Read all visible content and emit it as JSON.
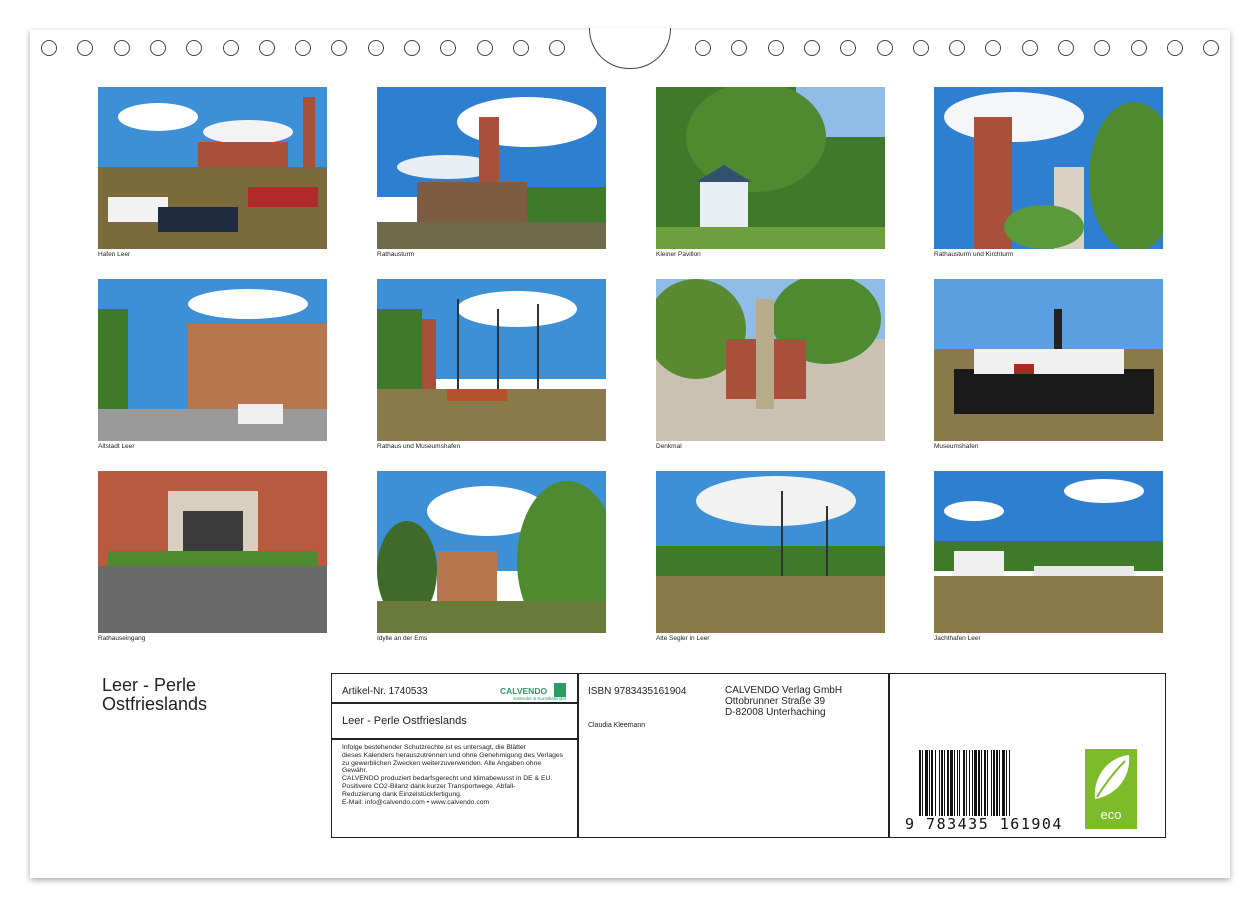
{
  "photos": [
    {
      "caption": "Hafen Leer"
    },
    {
      "caption": "Rathausturm"
    },
    {
      "caption": "Kleiner Pavillon"
    },
    {
      "caption": "Rathausturm und Kirchturm"
    },
    {
      "caption": "Altstadt Leer"
    },
    {
      "caption": "Rathaus und Museumshafen"
    },
    {
      "caption": "Denkmal"
    },
    {
      "caption": "Museumshafen"
    },
    {
      "caption": "Rathauseingang"
    },
    {
      "caption": "Idylle an der Ems"
    },
    {
      "caption": "Alte Segler in Leer"
    },
    {
      "caption": "Jachthafen Leer"
    }
  ],
  "calendar_title_line1": "Leer - Perle",
  "calendar_title_line2": "Ostfrieslands",
  "info": {
    "article_no": "Artikel-Nr. 1740533",
    "brand": "CALVENDO",
    "brand_tagline": "Kalender & Kunstkalender",
    "product_title": "Leer - Perle Ostfrieslands",
    "legal_lines": [
      "Infolge bestehender Schutzrechte ist es untersagt, die Blätter",
      "dieses Kalenders herauszutrennen und ohne Genehmigung des Verlages",
      "zu gewerblichen Zwecken weiterzuverwenden. Alle Angaben ohne",
      "Gewähr.",
      "CALVENDO produziert bedarfsgerecht und klimabewusst in DE & EU.",
      "Positivere CO2-Bilanz dank kurzer Transportwege. Abfall-",
      "Reduzierung dank Einzelstückfertigung.",
      "E-Mail: info@calvendo.com • www.calvendo.com"
    ],
    "isbn": "ISBN 9783435161904",
    "author": "Claudia Kleemann",
    "publisher_name": "CALVENDO Verlag GmbH",
    "publisher_street": "Ottobrunner Straße 39",
    "publisher_city": "D-82008 Unterhaching",
    "barcode_number": "9  783435  161904",
    "eco_label": "eco"
  },
  "colors": {
    "sky": "#3d8fd6",
    "water": "#8a7a4a",
    "brick": "#a9503a",
    "green": "#3f7a2a",
    "eco_green": "#7dbb2a",
    "calvendo_green": "#2e9a63"
  }
}
